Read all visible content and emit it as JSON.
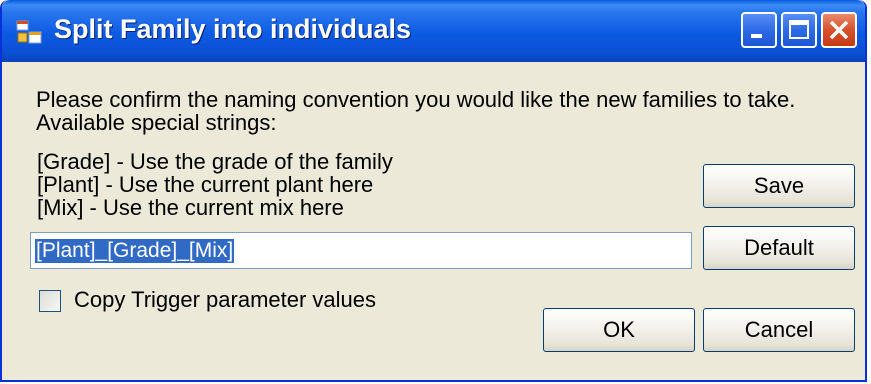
{
  "window": {
    "title": "Split Family into individuals",
    "icons": {
      "app": "app-window-icon",
      "minimize": "minimize-icon",
      "maximize": "maximize-icon",
      "close": "close-icon"
    }
  },
  "content": {
    "intro_line1": "Please confirm the naming convention you would like the new families to take.",
    "intro_line2": "Available special strings:",
    "strings": [
      "[Grade] - Use the grade of the family",
      "[Plant] - Use the current plant here",
      "[Mix] - Use the current mix here"
    ],
    "naming_value": "[Plant]_[Grade]_[Mix]",
    "copy_trigger_label": "Copy Trigger parameter values",
    "copy_trigger_checked": false
  },
  "buttons": {
    "save": "Save",
    "default": "Default",
    "ok": "OK",
    "cancel": "Cancel"
  }
}
